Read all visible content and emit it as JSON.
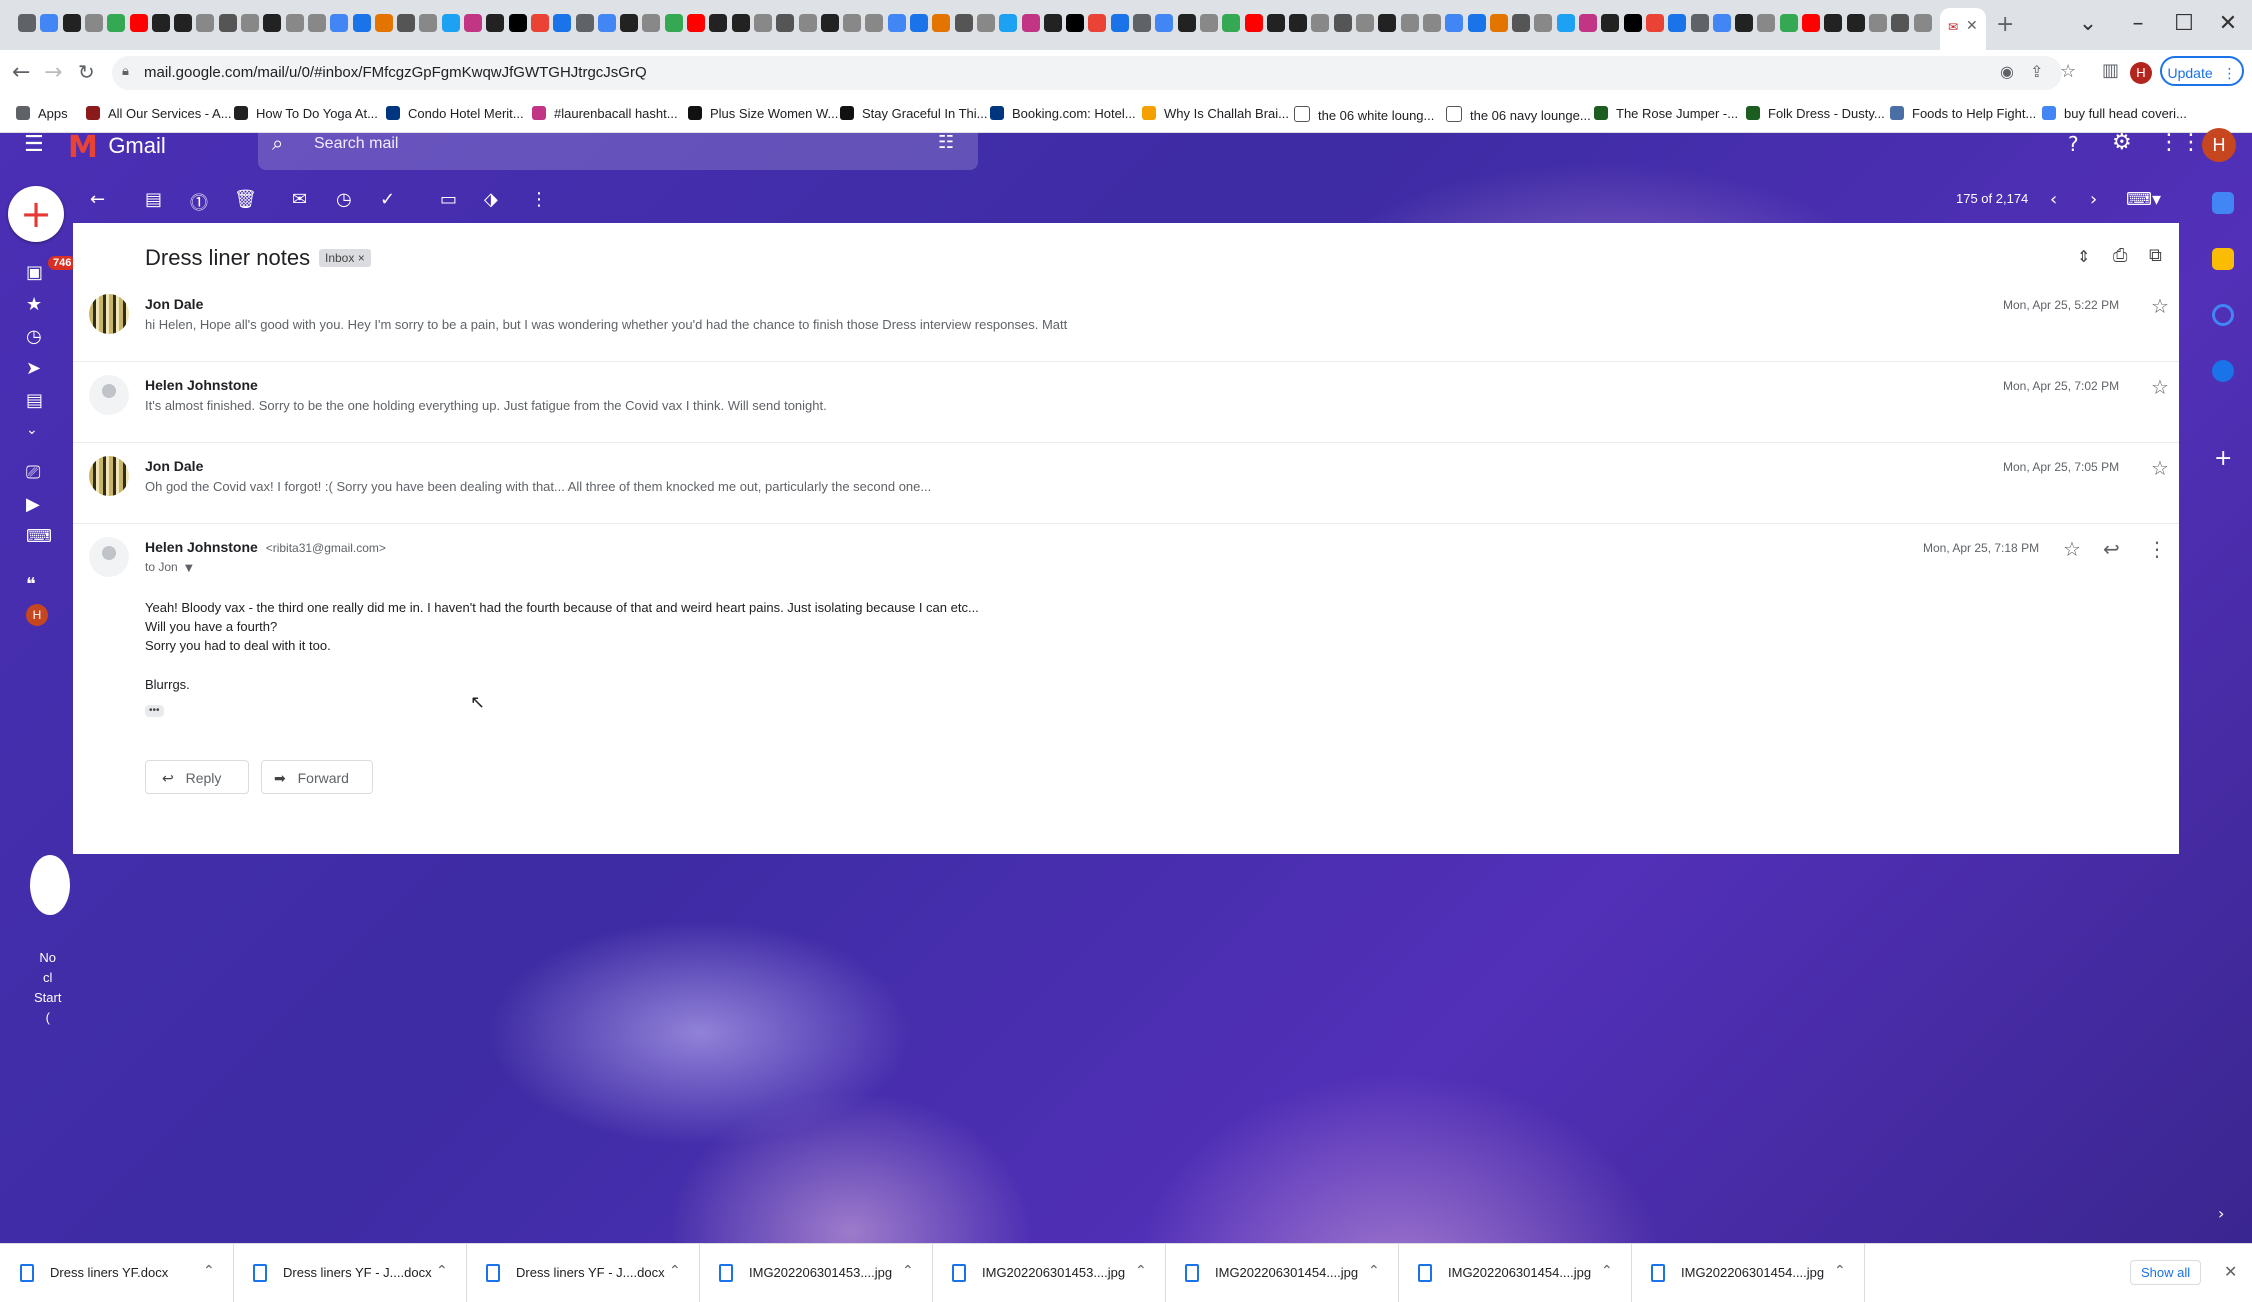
{
  "browser": {
    "tab_close": "✕",
    "new_tab": "+",
    "url": "mail.google.com/mail/u/0/#inbox/FMfcgzGpFgmKwqwJfGWTGHJtrgcJsGrQ",
    "update_label": "Update",
    "profile_initial": "H",
    "bookmarks": [
      {
        "label": "Apps",
        "color": "#5f6368"
      },
      {
        "label": "All Our Services - A...",
        "color": "#8b1a1a"
      },
      {
        "label": "How To Do Yoga At...",
        "color": "#222222"
      },
      {
        "label": "Condo Hotel Merit...",
        "color": "#003580"
      },
      {
        "label": "#laurenbacall hasht...",
        "color": "#c13584"
      },
      {
        "label": "Plus Size Women W...",
        "color": "#111111"
      },
      {
        "label": "Stay Graceful In Thi...",
        "color": "#111111"
      },
      {
        "label": "Booking.com: Hotel...",
        "color": "#003580"
      },
      {
        "label": "Why Is Challah Brai...",
        "color": "#f4a100"
      },
      {
        "label": "the 06 white loung...",
        "color": "#ffffff"
      },
      {
        "label": "the 06 navy lounge...",
        "color": "#ffffff"
      },
      {
        "label": "The Rose Jumper -...",
        "color": "#1b5e20"
      },
      {
        "label": "Folk Dress - Dusty...",
        "color": "#1b5e20"
      },
      {
        "label": "Foods to Help Fight...",
        "color": "#4a6fa5"
      },
      {
        "label": "buy full head coveri...",
        "color": "#4285f4"
      }
    ]
  },
  "gmail": {
    "logo_text": "Gmail",
    "search_placeholder": "Search mail",
    "account_initial": "H",
    "unread_count": "746",
    "pager": "175 of 2,174",
    "left_hint": [
      "No",
      "cl",
      "Start",
      "("
    ]
  },
  "thread": {
    "subject": "Dress liner notes",
    "label_chip": "Inbox",
    "label_chip_remove": "×",
    "messages": [
      {
        "sender": "Jon Dale",
        "snippet": "hi Helen, Hope all's good with you. Hey I'm sorry to be a pain, but I was wondering whether you'd had the chance to finish those Dress interview responses. Matt",
        "date": "Mon, Apr 25, 5:22 PM"
      },
      {
        "sender": "Helen Johnstone",
        "snippet": "It's almost finished. Sorry to be the one holding everything up. Just fatigue from the Covid vax I think. Will send tonight.",
        "date": "Mon, Apr 25, 7:02 PM"
      },
      {
        "sender": "Jon Dale",
        "snippet": "Oh god the Covid vax! I forgot! :( Sorry you have been dealing with that... All three of them knocked me out, particularly the second one...",
        "date": "Mon, Apr 25, 7:05 PM"
      }
    ],
    "open_message": {
      "sender": "Helen Johnstone",
      "email": "<ribita31@gmail.com>",
      "to": "to Jon",
      "date": "Mon, Apr 25, 7:18 PM",
      "body": [
        "Yeah! Bloody vax - the third one really did me in. I haven't had the fourth because of that and weird heart pains. Just isolating because I can etc...",
        "Will you have a fourth?",
        "Sorry you had to deal with it too.",
        "Blurrgs."
      ],
      "trimmed": "•••"
    },
    "reply_label": "Reply",
    "forward_label": "Forward"
  },
  "downloads": {
    "items": [
      "Dress liners YF.docx",
      "Dress liners YF - J....docx",
      "Dress liners YF - J....docx",
      "IMG202206301453....jpg",
      "IMG202206301453....jpg",
      "IMG202206301454....jpg",
      "IMG202206301454....jpg",
      "IMG202206301454....jpg"
    ],
    "show_all": "Show all",
    "close": "✕"
  }
}
